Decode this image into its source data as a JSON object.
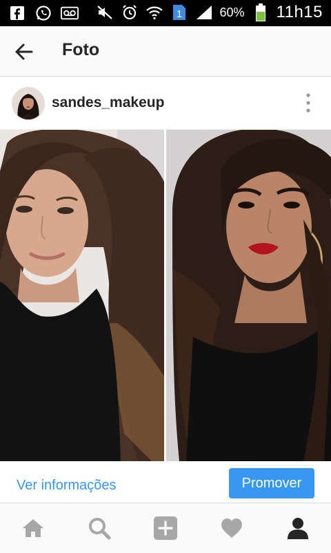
{
  "status_bar": {
    "icons": [
      "facebook-icon",
      "whatsapp-icon",
      "voicemail-icon",
      "mute-icon",
      "alarm-icon",
      "wifi-icon",
      "sim-icon",
      "signal-icon",
      "battery-icon"
    ],
    "sim_number": "1",
    "battery": "60%",
    "time": "11h15",
    "battery_color": "#7cc142"
  },
  "app_bar": {
    "title": "Foto",
    "back_icon": "arrow-left-icon"
  },
  "post": {
    "username": "sandes_makeup",
    "avatar_icon": "avatar",
    "more_icon": "more-vertical-icon",
    "photo_description": ""
  },
  "actions": {
    "info_link": "Ver informações",
    "promote_label": "Promover",
    "accent_color": "#3897f0"
  },
  "tab_bar": {
    "tabs": [
      {
        "name": "home",
        "icon": "home-icon"
      },
      {
        "name": "search",
        "icon": "search-icon"
      },
      {
        "name": "add",
        "icon": "plus-square-icon"
      },
      {
        "name": "activity",
        "icon": "heart-icon"
      },
      {
        "name": "profile",
        "icon": "person-icon"
      }
    ]
  }
}
